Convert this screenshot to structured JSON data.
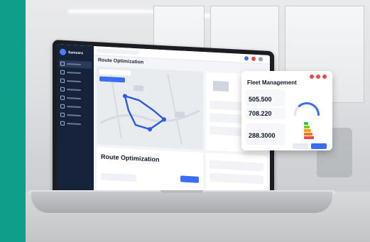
{
  "brand": {
    "accent_bar_color": "#0f9e8a"
  },
  "laptop_app": {
    "brand_name": "Samsara",
    "title": "Route Optimization",
    "bottom_card_title": "Route Optimization",
    "primary_button_color": "#3b6ef5",
    "sidebar_color": "#16223a",
    "icons": [
      "logo-icon",
      "search-icon",
      "truck-icon",
      "map-pin-icon"
    ]
  },
  "floating_card": {
    "title": "Fleet Management",
    "stats": [
      {
        "value": "505.500"
      },
      {
        "value": "708.220"
      },
      {
        "value": "288.3000"
      }
    ],
    "gauge_level": 0.7,
    "status_colors": [
      "#e24b4b",
      "#f59e0b",
      "#22c55e"
    ]
  }
}
